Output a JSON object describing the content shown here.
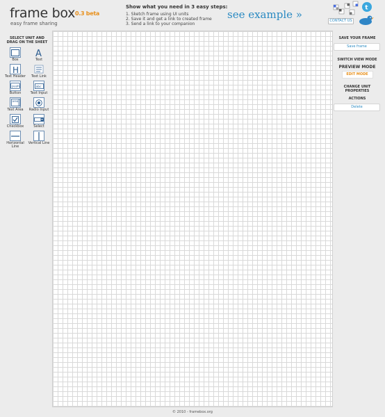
{
  "logo": {
    "title": "frame box",
    "version": "0.3 beta",
    "tagline": "easy frame sharing"
  },
  "steps": {
    "heading": "Show what you need in 3 easy steps:",
    "items": [
      "1. Sketch frame using UI units",
      "2. Save it and get a link to created frame",
      "3. Send a link to your companion"
    ]
  },
  "example_link": "see example »",
  "contact_label": "CONTACT US",
  "toolbox": {
    "title": "SELECT UNIT AND DRAG ON THE SHEET",
    "tools": [
      {
        "label": "Box",
        "icon": "box-icon"
      },
      {
        "label": "Text",
        "icon": "text-icon"
      },
      {
        "label": "Text Header",
        "icon": "text-header-icon"
      },
      {
        "label": "Text Link",
        "icon": "text-link-icon"
      },
      {
        "label": "Button",
        "icon": "button-icon"
      },
      {
        "label": "Text Input",
        "icon": "text-input-icon"
      },
      {
        "label": "Text Area",
        "icon": "text-area-icon"
      },
      {
        "label": "Radio Input",
        "icon": "radio-icon"
      },
      {
        "label": "Checkbox",
        "icon": "checkbox-icon"
      },
      {
        "label": "Select",
        "icon": "select-icon"
      },
      {
        "label": "Horizontal Line",
        "icon": "horizontal-line-icon"
      },
      {
        "label": "Vertical Line",
        "icon": "vertical-line-icon"
      }
    ]
  },
  "panel": {
    "save_heading": "SAVE YOUR FRAME",
    "save_button": "Save frame",
    "switch_heading": "SWITCH VIEW MODE",
    "preview_mode": "PREVIEW MODE",
    "edit_mode": "EDIT MODE",
    "props_heading": "CHANGE UNIT PROPERTIES",
    "actions_heading": "ACTIONS",
    "delete_button": "Delete"
  },
  "footer": "© 2010 - framebox.org",
  "colors": {
    "accent_orange": "#e8901c",
    "link_blue": "#2a8ac2",
    "icon_border": "#6b8db2"
  }
}
